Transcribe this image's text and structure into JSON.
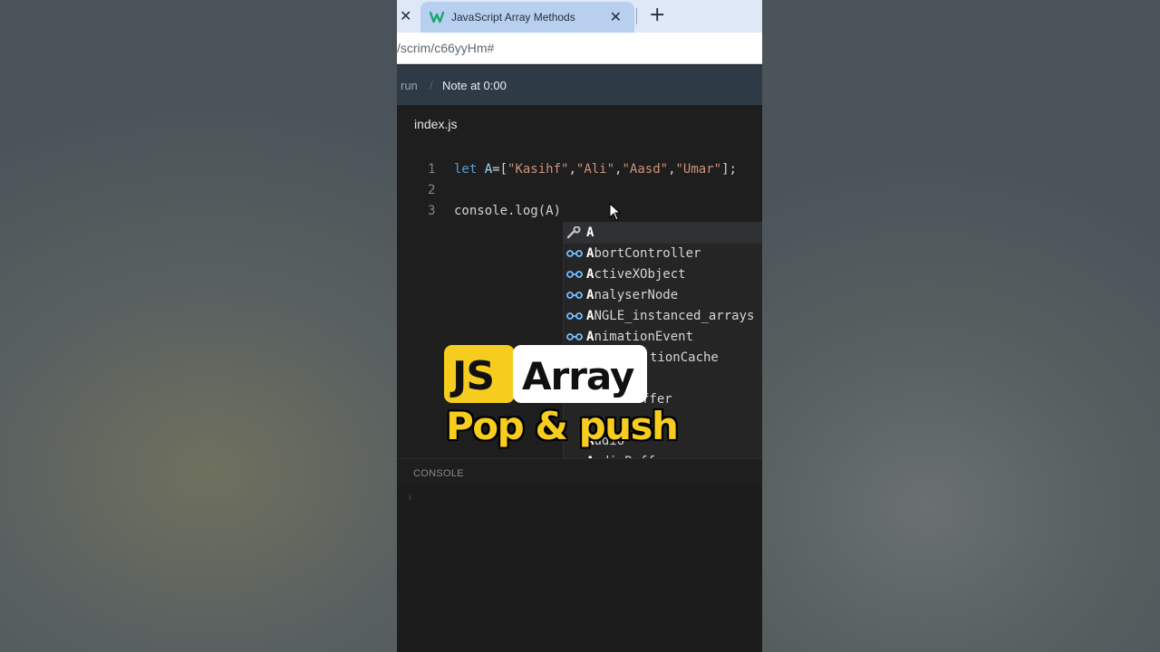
{
  "browser": {
    "tab_title": "JavaScript Array Methods",
    "close_glyph": "✕",
    "new_tab_glyph": "+",
    "url": "/scrim/c66yyHm#"
  },
  "scrimba": {
    "run_label": "run",
    "crumb_separator": "/",
    "note_label": "Note at 0:00"
  },
  "editor": {
    "file_name": "index.js",
    "line_numbers": [
      "1",
      "2",
      "3"
    ],
    "line1": {
      "kw": "let",
      "var": " A",
      "eq": "=[",
      "s1": "\"Kasihf\"",
      "c1": ",",
      "s2": "\"Ali\"",
      "c2": ",",
      "s3": "\"Aasd\"",
      "c3": ",",
      "s4": "\"Umar\"",
      "end": "];"
    },
    "line3": "console.log(A)"
  },
  "autocomplete": {
    "items": [
      {
        "bold": "A",
        "rest": "",
        "icon": "wrench-icon"
      },
      {
        "bold": "A",
        "rest": "bortController",
        "icon": "interface-icon"
      },
      {
        "bold": "A",
        "rest": "ctiveXObject",
        "icon": "interface-icon"
      },
      {
        "bold": "A",
        "rest": "nalyserNode",
        "icon": "interface-icon"
      },
      {
        "bold": "A",
        "rest": "NGLE_instanced_arrays",
        "icon": "interface-icon"
      },
      {
        "bold": "A",
        "rest": "nimationEvent",
        "icon": "interface-icon"
      },
      {
        "bold": "",
        "rest": "tionCache",
        "icon": "interface-icon"
      },
      {
        "bold": "",
        "rest": "ffer",
        "icon": "interface-icon"
      },
      {
        "bold": "",
        "rest": "",
        "icon": "interface-icon"
      },
      {
        "bold": "A",
        "rest": "udio",
        "icon": "interface-icon"
      },
      {
        "bold": "A",
        "rest": "udioBuffer",
        "icon": "interface-icon"
      }
    ]
  },
  "console": {
    "label": "CONSOLE",
    "prompt": "›"
  },
  "overlay": {
    "badge_js": "JS",
    "badge_array": "Array",
    "subtitle": "Pop & push"
  },
  "colors": {
    "accent_yellow": "#f6cd1f",
    "editor_bg": "#1e1e1e",
    "header_bg": "#2f3a47",
    "tab_active": "#b9cff0"
  }
}
